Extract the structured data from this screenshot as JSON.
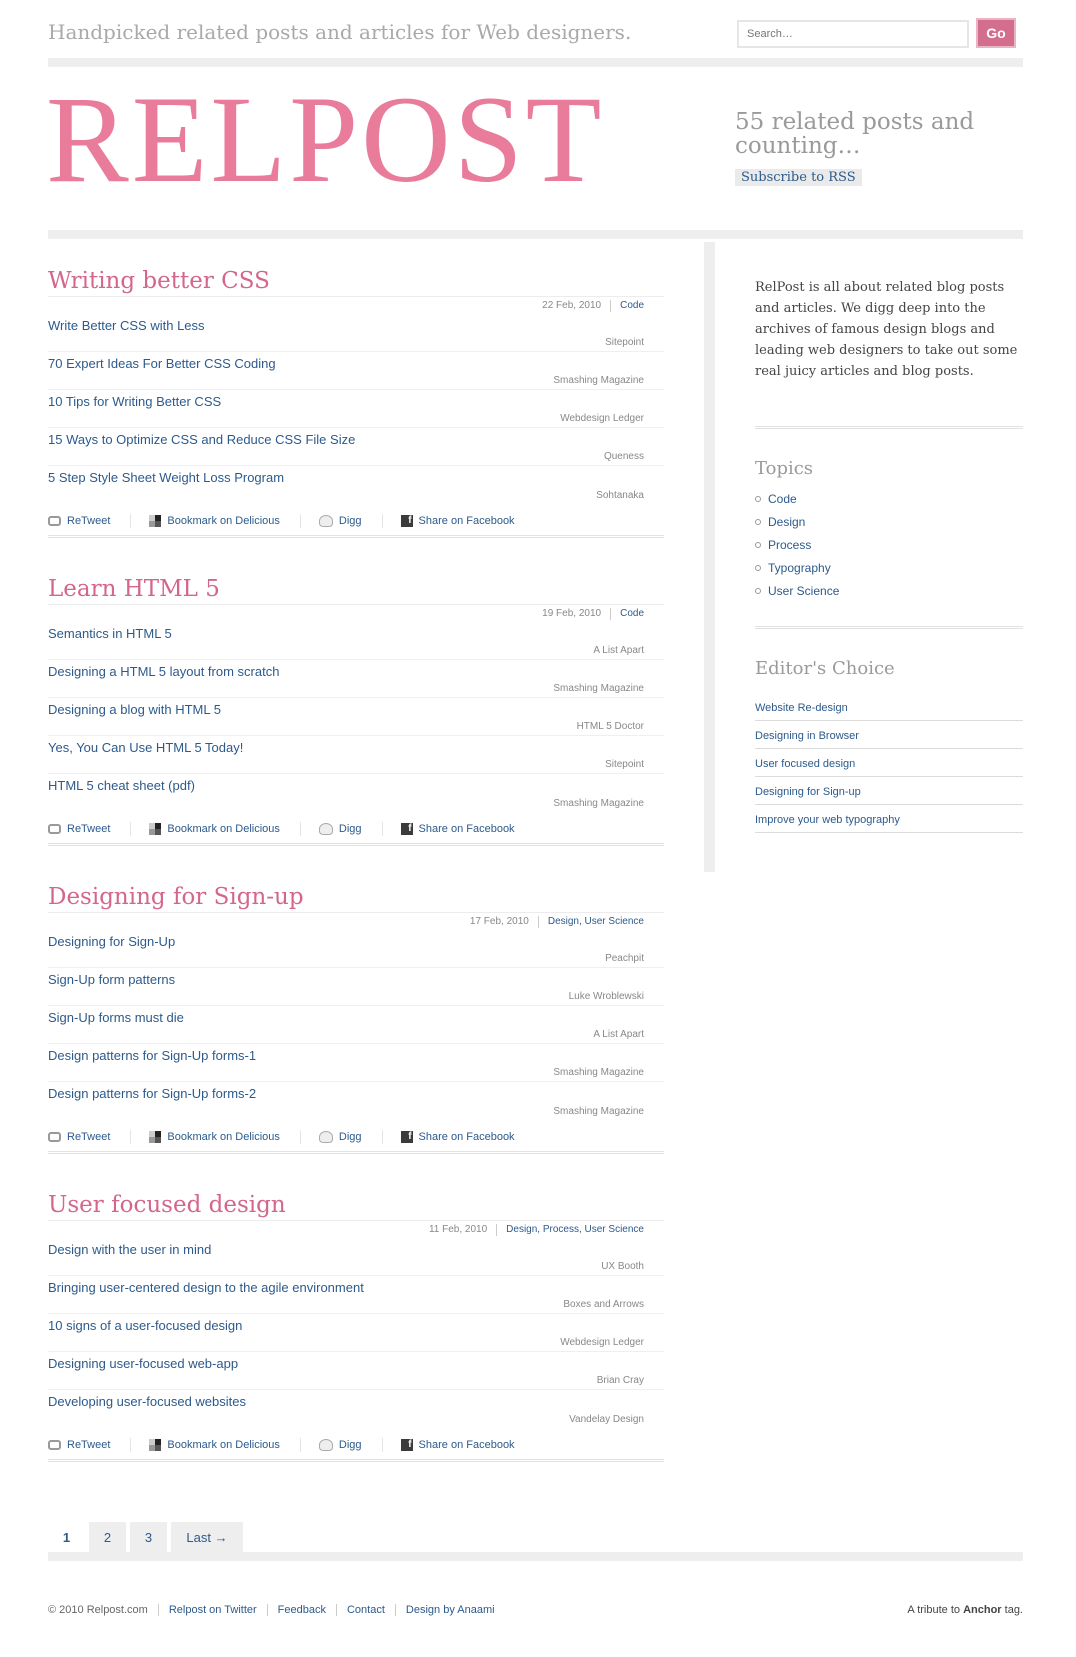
{
  "header": {
    "tagline": "Handpicked related posts and articles for Web designers.",
    "search_placeholder": "Search…",
    "go_label": "Go",
    "logo": "RELPOST",
    "count_text": "55 related posts and counting…",
    "rss_label": "Subscribe to RSS"
  },
  "posts": [
    {
      "title": "Writing better CSS",
      "date": "22 Feb, 2010",
      "categories": "Code",
      "links": [
        {
          "title": "Write Better CSS with Less",
          "source": "Sitepoint"
        },
        {
          "title": "70 Expert Ideas For Better CSS Coding",
          "source": "Smashing Magazine"
        },
        {
          "title": "10 Tips for Writing Better CSS",
          "source": "Webdesign Ledger"
        },
        {
          "title": "15 Ways to Optimize CSS and Reduce CSS File Size",
          "source": "Queness"
        },
        {
          "title": "5 Step Style Sheet Weight Loss Program",
          "source": "Sohtanaka"
        }
      ]
    },
    {
      "title": "Learn HTML 5",
      "date": "19 Feb, 2010",
      "categories": "Code",
      "links": [
        {
          "title": "Semantics in HTML 5",
          "source": "A List Apart"
        },
        {
          "title": "Designing a HTML 5 layout from scratch",
          "source": "Smashing Magazine"
        },
        {
          "title": "Designing a blog with HTML 5",
          "source": "HTML 5 Doctor"
        },
        {
          "title": "Yes, You Can Use HTML 5 Today!",
          "source": "Sitepoint"
        },
        {
          "title": "HTML 5 cheat sheet (pdf)",
          "source": "Smashing Magazine"
        }
      ]
    },
    {
      "title": "Designing for Sign-up",
      "date": "17 Feb, 2010",
      "categories": "Design, User Science",
      "links": [
        {
          "title": "Designing for Sign-Up",
          "source": "Peachpit"
        },
        {
          "title": "Sign-Up form patterns",
          "source": "Luke Wroblewski"
        },
        {
          "title": "Sign-Up forms must die",
          "source": "A List Apart"
        },
        {
          "title": "Design patterns for Sign-Up forms-1",
          "source": "Smashing Magazine"
        },
        {
          "title": "Design patterns for Sign-Up forms-2",
          "source": "Smashing Magazine"
        }
      ]
    },
    {
      "title": "User focused design",
      "date": "11 Feb, 2010",
      "categories": "Design, Process, User Science",
      "links": [
        {
          "title": "Design with the user in mind",
          "source": "UX Booth"
        },
        {
          "title": "Bringing user-centered design to the agile environment",
          "source": "Boxes and Arrows"
        },
        {
          "title": "10 signs of a user-focused design",
          "source": "Webdesign Ledger"
        },
        {
          "title": "Designing user-focused web-app",
          "source": "Brian Cray"
        },
        {
          "title": "Developing user-focused websites",
          "source": "Vandelay Design"
        }
      ]
    }
  ],
  "share": {
    "retweet": "ReTweet",
    "delicious": "Bookmark on Delicious",
    "digg": "Digg",
    "facebook": "Share on Facebook"
  },
  "sidebar": {
    "about": "RelPost is all about related blog posts and articles. We digg deep into the archives of famous design blogs and leading web designers to take out some real juicy articles and blog posts.",
    "topics_heading": "Topics",
    "topics": [
      "Code",
      "Design",
      "Process",
      "Typography",
      "User Science"
    ],
    "editors_heading": "Editor's Choice",
    "editors": [
      "Website Re-design",
      "Designing in Browser",
      "User focused design",
      "Designing for Sign-up",
      "Improve your web typography"
    ]
  },
  "pagination": {
    "pages": [
      "1",
      "2",
      "3"
    ],
    "current": "1",
    "last_label": "Last →"
  },
  "footer": {
    "copyright": "© 2010 Relpost.com",
    "links": [
      "Relpost on Twitter",
      "Feedback",
      "Contact",
      "Design by Anaami"
    ],
    "tribute_prefix": "A tribute to",
    "tribute_bold": "Anchor",
    "tribute_suffix": "tag."
  },
  "colors": {
    "accent_pink": "#e97b9b",
    "title_pink": "#d4668a",
    "link_blue": "#2c5a8c"
  }
}
